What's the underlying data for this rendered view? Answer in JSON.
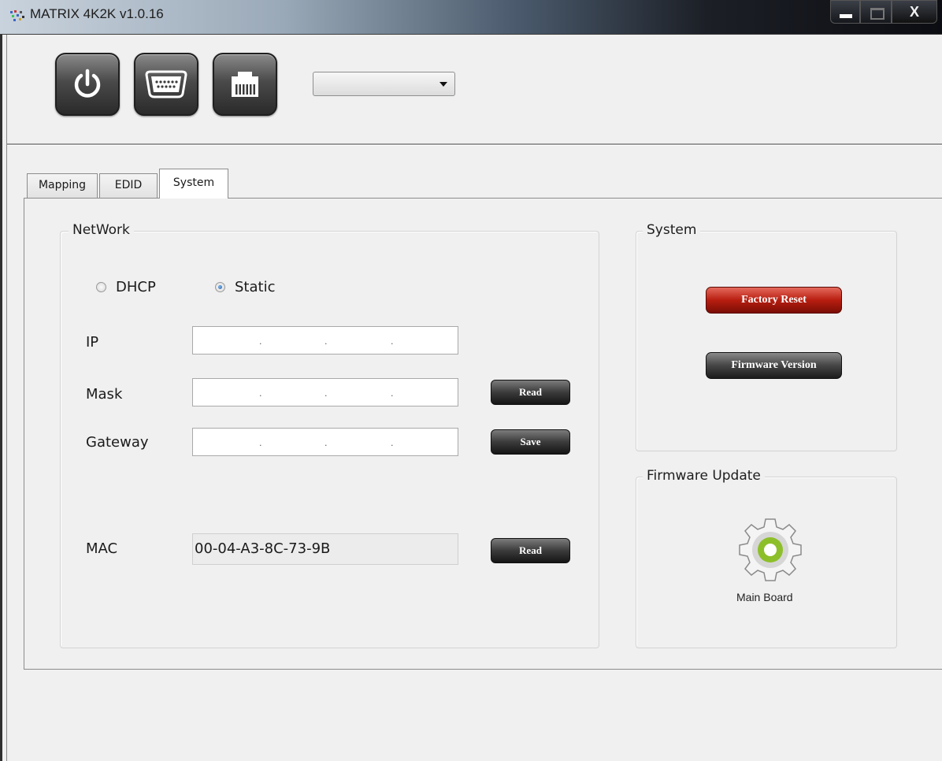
{
  "window": {
    "title": "MATRIX 4K2K v1.0.16",
    "close_label": "X"
  },
  "toolbar": {
    "device_select_value": ""
  },
  "tabs": [
    {
      "label": "Mapping",
      "active": false
    },
    {
      "label": "EDID",
      "active": false
    },
    {
      "label": "System",
      "active": true
    }
  ],
  "network": {
    "title": "NetWork",
    "mode_options": [
      {
        "label": "DHCP",
        "checked": false
      },
      {
        "label": "Static",
        "checked": true
      }
    ],
    "ip_label": "IP",
    "mask_label": "Mask",
    "gateway_label": "Gateway",
    "mac_label": "MAC",
    "mac_value": "00-04-A3-8C-73-9B",
    "read_label": "Read",
    "save_label": "Save",
    "mac_read_label": "Read",
    "ip_separator": "."
  },
  "system": {
    "title": "System",
    "factory_reset_label": "Factory Reset",
    "firmware_version_label": "Firmware Version"
  },
  "firmware_update": {
    "title": "Firmware Update",
    "main_board_label": "Main Board"
  },
  "colors": {
    "reset_red": "#b81e10",
    "gear_green": "#8dbf2a",
    "radio_blue": "#1f5ea8"
  },
  "icons": [
    "app-icon",
    "power-icon",
    "serial-port-icon",
    "network-port-icon",
    "gear-icon",
    "dropdown-arrow-icon"
  ]
}
